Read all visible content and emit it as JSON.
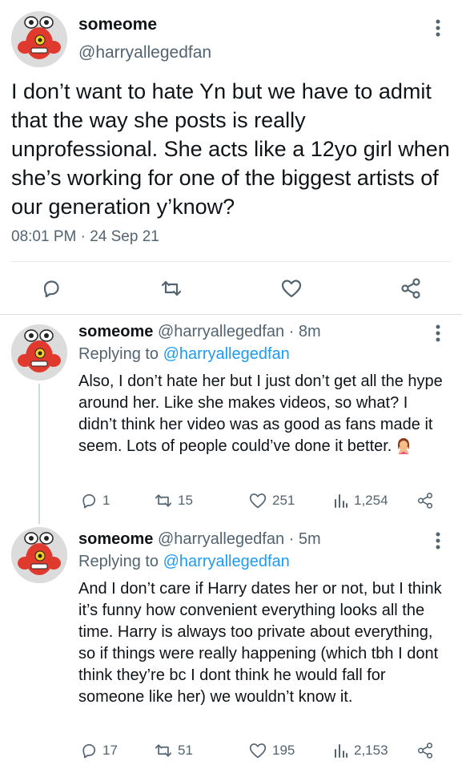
{
  "main_tweet": {
    "name": "someome",
    "handle": "@harryallegedfan",
    "text": "I don’t want to hate Yn but we have to admit that the way she posts is really unprofessional. She acts like a 12yo girl when she’s working for one of the biggest artists of our generation y’know?",
    "timestamp": "08:01 PM · 24 Sep 21",
    "actions": [
      "reply-icon",
      "retweet-icon",
      "like-icon",
      "share-icon"
    ]
  },
  "replies": [
    {
      "name": "someome",
      "handle_time": "@harryallegedfan · 8m",
      "replying_prefix": "Replying to ",
      "replying_to": "@harryallegedfan",
      "text": "Also, I don’t hate her but I just don’t get all the hype around her. Like she makes videos, so what? I didn’t think her video was as good as fans made it seem. Lots of people could’ve done it better.",
      "emoji": "person-gesturing-no",
      "replies_count": "1",
      "retweets": "15",
      "likes": "251",
      "views": "1,254"
    },
    {
      "name": "someome",
      "handle_time": "@harryallegedfan · 5m",
      "replying_prefix": "Replying to ",
      "replying_to": "@harryallegedfan",
      "text": "And I don’t care if Harry dates her or not, but I think it’s funny how convenient everything looks all the time. Harry is always too private about everything, so if things were really happening (which tbh I dont think they’re bc I dont think he would fall for someone like her) we wouldn’t know it.",
      "replies_count": "17",
      "retweets": "51",
      "likes": "195",
      "views": "2,153"
    }
  ],
  "colors": {
    "text": "#0f1419",
    "secondary": "#536471",
    "link": "#1d9bf0",
    "avatar_red": "#e03a2f"
  }
}
